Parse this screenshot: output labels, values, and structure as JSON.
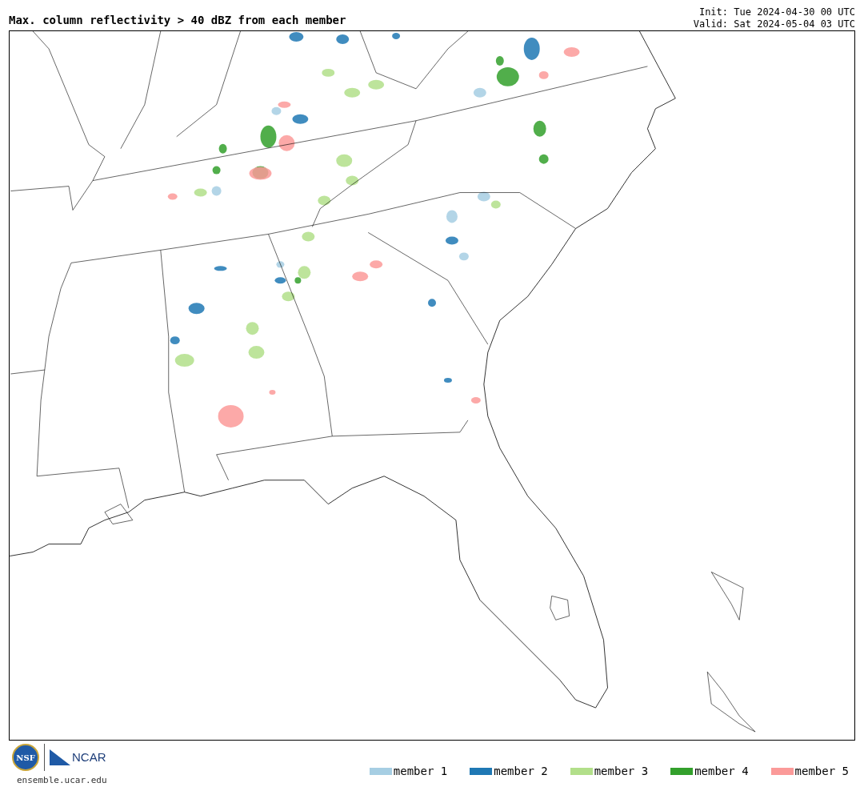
{
  "title": "Max. column reflectivity > 40 dBZ from each member",
  "init": "Init: Tue 2024-04-30 00 UTC",
  "valid": "Valid: Sat 2024-05-04 03 UTC",
  "logos": {
    "nsf": "NSF",
    "ncar": "NCAR"
  },
  "site": "ensemble.ucar.edu",
  "legend": [
    {
      "label": "member 1",
      "color": "#a6cee3"
    },
    {
      "label": "member 2",
      "color": "#1f78b4"
    },
    {
      "label": "member 3",
      "color": "#b2df8a"
    },
    {
      "label": "member 4",
      "color": "#33a02c"
    },
    {
      "label": "member 5",
      "color": "#fb9a99"
    }
  ]
}
